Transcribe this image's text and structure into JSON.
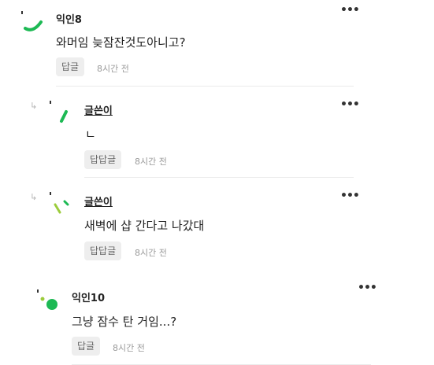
{
  "comments": [
    {
      "author": "익인8",
      "text": "와머임 늦잠잔것도아니고?",
      "reply_label": "답글",
      "time": "8시간 전",
      "more": "•••"
    },
    {
      "author": "글쓴이",
      "text": "ㄴ",
      "reply_label": "답답글",
      "time": "8시간 전",
      "more": "•••",
      "reply_icon": "reply-arrow-icon"
    },
    {
      "author": "글쓴이",
      "text": "새벽에 샵 간다고 나갔대",
      "reply_label": "답답글",
      "time": "8시간 전",
      "more": "•••",
      "reply_icon": "reply-arrow-icon"
    },
    {
      "author": "익인10",
      "text": "그냥 잠수 탄 거임...?",
      "reply_label": "답글",
      "time": "8시간 전",
      "more": "•••"
    }
  ],
  "colors": {
    "avatar_green": "#1db954",
    "avatar_lime": "#9ccc3c"
  }
}
